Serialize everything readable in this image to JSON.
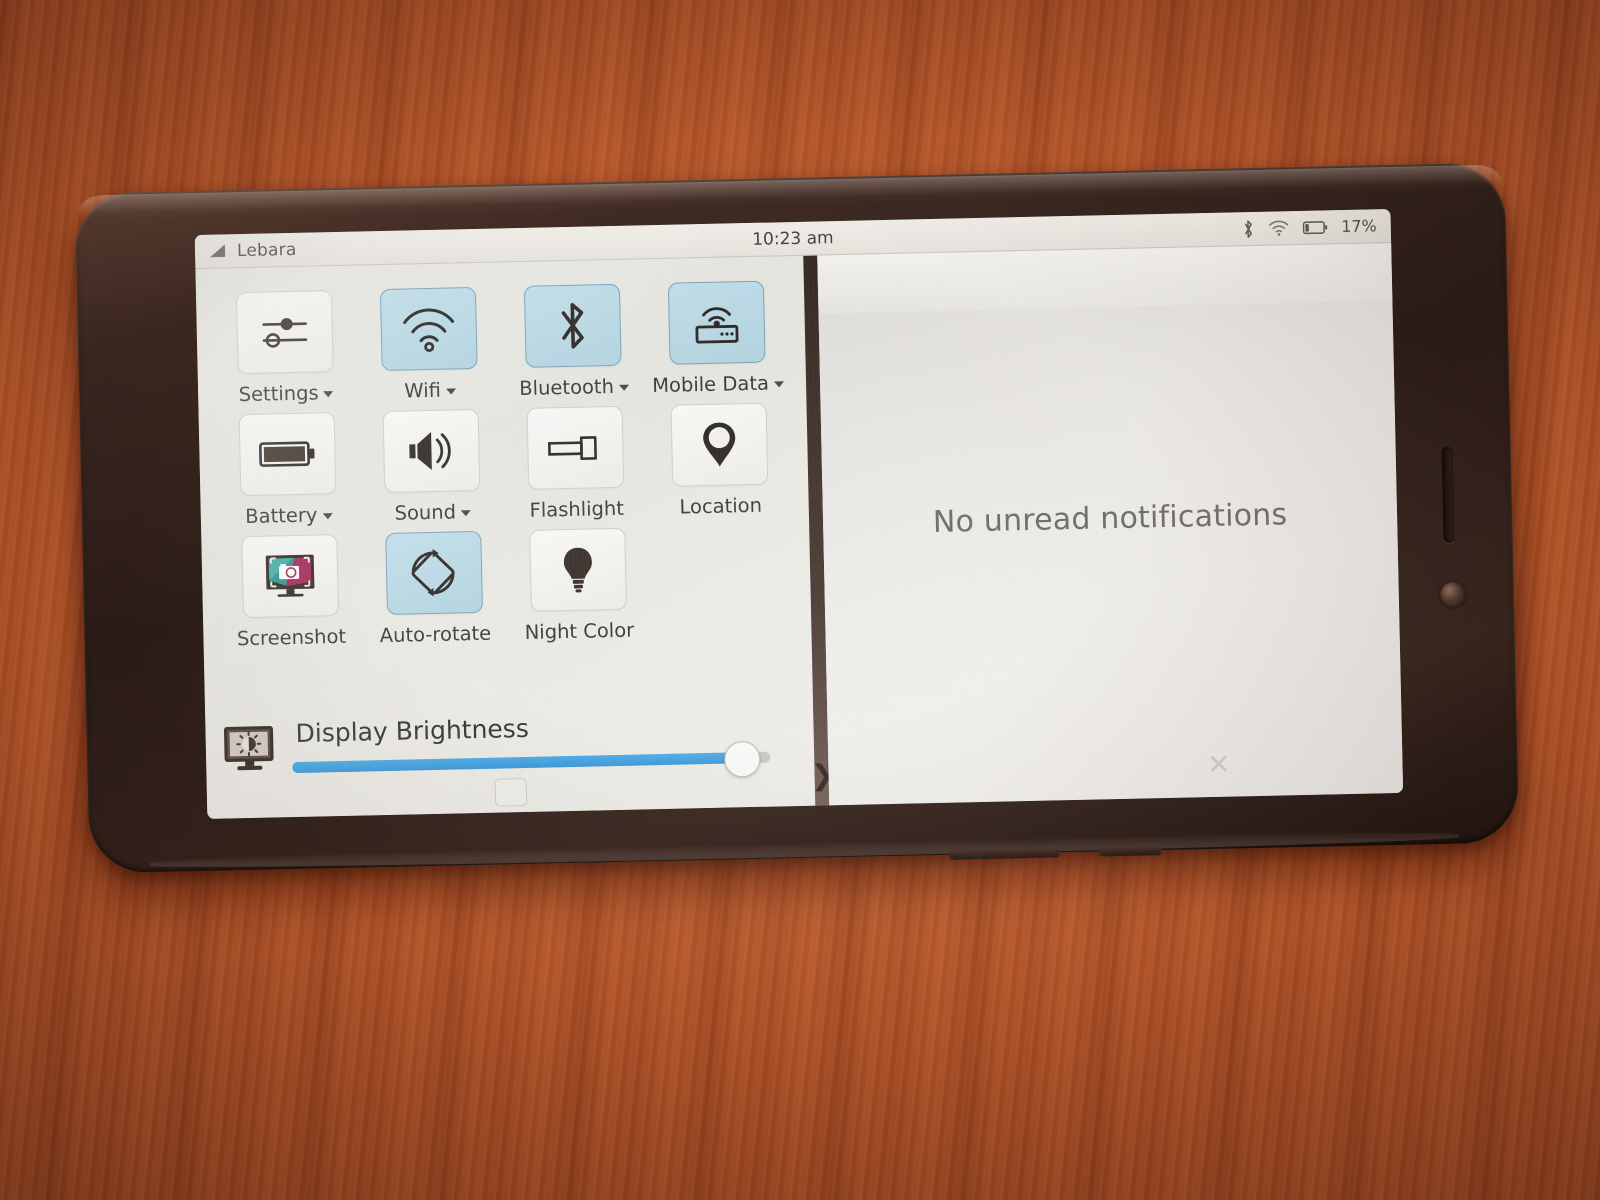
{
  "status_bar": {
    "carrier": "Lebara",
    "signal_icon": "signal-bars-icon",
    "clock": "10:23 am",
    "bluetooth_icon": "bluetooth-icon",
    "wifi_icon": "wifi-icon",
    "battery_icon": "battery-icon",
    "battery_percent": "17%"
  },
  "quick_settings": {
    "tiles": [
      {
        "label": "Settings",
        "icon": "sliders-icon",
        "has_dropdown": true,
        "active": false
      },
      {
        "label": "Wifi",
        "icon": "wifi-icon",
        "has_dropdown": true,
        "active": true
      },
      {
        "label": "Bluetooth",
        "icon": "bluetooth-icon",
        "has_dropdown": true,
        "active": true
      },
      {
        "label": "Mobile Data",
        "icon": "router-icon",
        "has_dropdown": true,
        "active": true
      },
      {
        "label": "Battery",
        "icon": "battery-icon",
        "has_dropdown": true,
        "active": false
      },
      {
        "label": "Sound",
        "icon": "speaker-icon",
        "has_dropdown": true,
        "active": false
      },
      {
        "label": "Flashlight",
        "icon": "flashlight-icon",
        "has_dropdown": false,
        "active": false
      },
      {
        "label": "Location",
        "icon": "map-pin-icon",
        "has_dropdown": false,
        "active": false
      },
      {
        "label": "Screenshot",
        "icon": "screenshot-icon",
        "has_dropdown": false,
        "active": false
      },
      {
        "label": "Auto-rotate",
        "icon": "auto-rotate-icon",
        "has_dropdown": false,
        "active": true
      },
      {
        "label": "Night Color",
        "icon": "lightbulb-icon",
        "has_dropdown": false,
        "active": false
      }
    ],
    "brightness": {
      "label": "Display Brightness",
      "icon": "display-brightness-icon",
      "value_percent": 94
    },
    "home_indicator": "home-indicator"
  },
  "notifications": {
    "empty_message": "No unread notifications",
    "close_icon": "close-icon"
  },
  "divider": {
    "chevron_icon": "chevron-right-icon"
  },
  "colors": {
    "tile_active_fill": "#a6cede",
    "tile_active_border": "#6e9cb8",
    "tile_inactive_fill": "#f4f4f0",
    "slider_fill": "#2f93d8",
    "panel_bg": "#e9e8e2",
    "status_bar_bg": "#eeeae3",
    "text": "#2e2e2c",
    "muted_text": "#5d5b58"
  }
}
